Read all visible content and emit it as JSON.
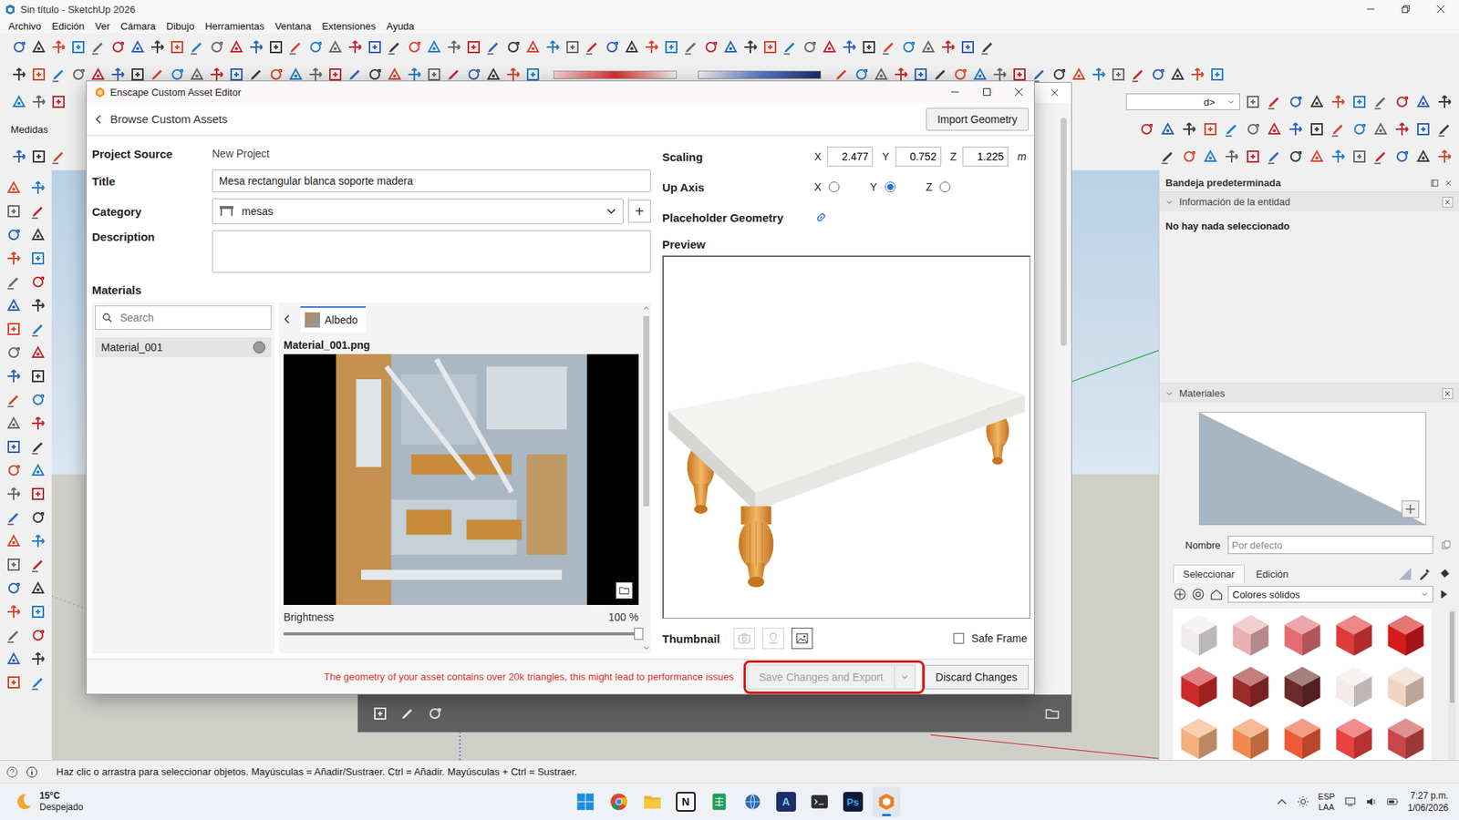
{
  "window": {
    "title": "Sin título - SketchUp 2026"
  },
  "menu": [
    "Archivo",
    "Edición",
    "Ver",
    "Cámara",
    "Dibujo",
    "Herramientas",
    "Ventana",
    "Extensiones",
    "Ayuda"
  ],
  "toolbar": {
    "style_dropdown": "d>",
    "measurements_label": "Medidas"
  },
  "tray_panel": {
    "title": "Bandeja predeterminada",
    "entity_info": {
      "title": "Información de la entidad",
      "expanded": true,
      "message": "No hay nada seleccionado"
    },
    "materials": {
      "title": "Materiales",
      "expanded": true,
      "name_label": "Nombre",
      "name_placeholder": "Por defecto",
      "tabs": [
        {
          "label": "Seleccionar",
          "selected": true
        },
        {
          "label": "Edición",
          "selected": false
        }
      ],
      "library": "Colores sólidos",
      "swatches": [
        {
          "color": "#f0ecec"
        },
        {
          "color": "#e8b0b4"
        },
        {
          "color": "#e26d72"
        },
        {
          "color": "#e03a3a"
        },
        {
          "color": "#d41c1c"
        },
        {
          "color": "#cc2a2a"
        },
        {
          "color": "#9c2b2b"
        },
        {
          "color": "#6b2a2a"
        },
        {
          "color": "#f3ecea"
        },
        {
          "color": "#f1d4c2"
        },
        {
          "color": "#f3b080"
        },
        {
          "color": "#f08a50"
        },
        {
          "color": "#ee5a35"
        },
        {
          "color": "#ea4040"
        },
        {
          "color": "#c84848"
        }
      ]
    }
  },
  "dialog": {
    "title": "Enscape Custom Asset Editor",
    "back_label": "Browse Custom Assets",
    "import_button": "Import Geometry",
    "fields": {
      "project_source": {
        "label": "Project Source",
        "value": "New Project"
      },
      "title": {
        "label": "Title",
        "value": "Mesa rectangular blanca soporte madera"
      },
      "category": {
        "label": "Category",
        "value": "mesas",
        "add": "+"
      },
      "description": {
        "label": "Description",
        "value": ""
      }
    },
    "materials": {
      "label": "Materials",
      "search_placeholder": "Search",
      "items": [
        {
          "name": "Material_001",
          "selected": true
        }
      ],
      "channel_tabs": [
        {
          "label": "Albedo",
          "selected": true
        }
      ],
      "file_name": "Material_001.png",
      "brightness": {
        "label": "Brightness",
        "reading": "100 %",
        "level": 1
      }
    },
    "scaling": {
      "label": "Scaling",
      "axes": [
        {
          "axis": "X",
          "value": "2.477"
        },
        {
          "axis": "Y",
          "value": "0.752"
        },
        {
          "axis": "Z",
          "value": "1.225"
        }
      ],
      "unit": "m"
    },
    "up_axis": {
      "label": "Up Axis",
      "options": [
        {
          "label": "X",
          "selected": false
        },
        {
          "label": "Y",
          "selected": true
        },
        {
          "label": "Z",
          "selected": false
        }
      ]
    },
    "placeholder_geometry": {
      "label": "Placeholder Geometry"
    },
    "preview": {
      "label": "Preview"
    },
    "thumbnail": {
      "label": "Thumbnail",
      "actions": [
        {
          "kind": "camera",
          "disabled": true
        },
        {
          "kind": "pin",
          "disabled": true
        },
        {
          "kind": "image",
          "disabled": false
        }
      ],
      "safe_frame": {
        "label": "Safe Frame",
        "checked": false
      }
    },
    "warning": "The geometry of your asset contains over 20k triangles, this might lead to performance issues",
    "buttons": [
      {
        "label": "Save Changes and Export",
        "disabled": true,
        "highlighted": true
      },
      {
        "label": "Discard Changes",
        "disabled": false,
        "highlighted": false
      }
    ]
  },
  "status_bar": {
    "hint": "Haz clic o arrastra para seleccionar objetos. Mayúsculas = Añadir/Sustraer. Ctrl = Añadir. Mayúsculas + Ctrl = Sustraer."
  },
  "taskbar": {
    "weather": {
      "temp": "15°C",
      "condition": "Despejado"
    },
    "apps": [
      {
        "kind": "windows",
        "glyph": "",
        "selected": false
      },
      {
        "kind": "chrome",
        "glyph": "",
        "selected": false
      },
      {
        "kind": "folder",
        "glyph": "",
        "selected": false
      },
      {
        "kind": "notion",
        "glyph": "N",
        "selected": false
      },
      {
        "kind": "sheet",
        "glyph": "",
        "selected": false
      },
      {
        "kind": "globe",
        "glyph": "",
        "selected": false
      },
      {
        "kind": "letter",
        "glyph": "A",
        "selected": false
      },
      {
        "kind": "terminal",
        "glyph": "",
        "selected": false
      },
      {
        "kind": "photoshop",
        "glyph": "Ps",
        "selected": false
      },
      {
        "kind": "sketchup",
        "glyph": "",
        "selected": true
      }
    ],
    "language": {
      "lang": "ESP",
      "layout": "LAA"
    },
    "time": "7:27 p.m.",
    "date": "1/06/2026"
  }
}
